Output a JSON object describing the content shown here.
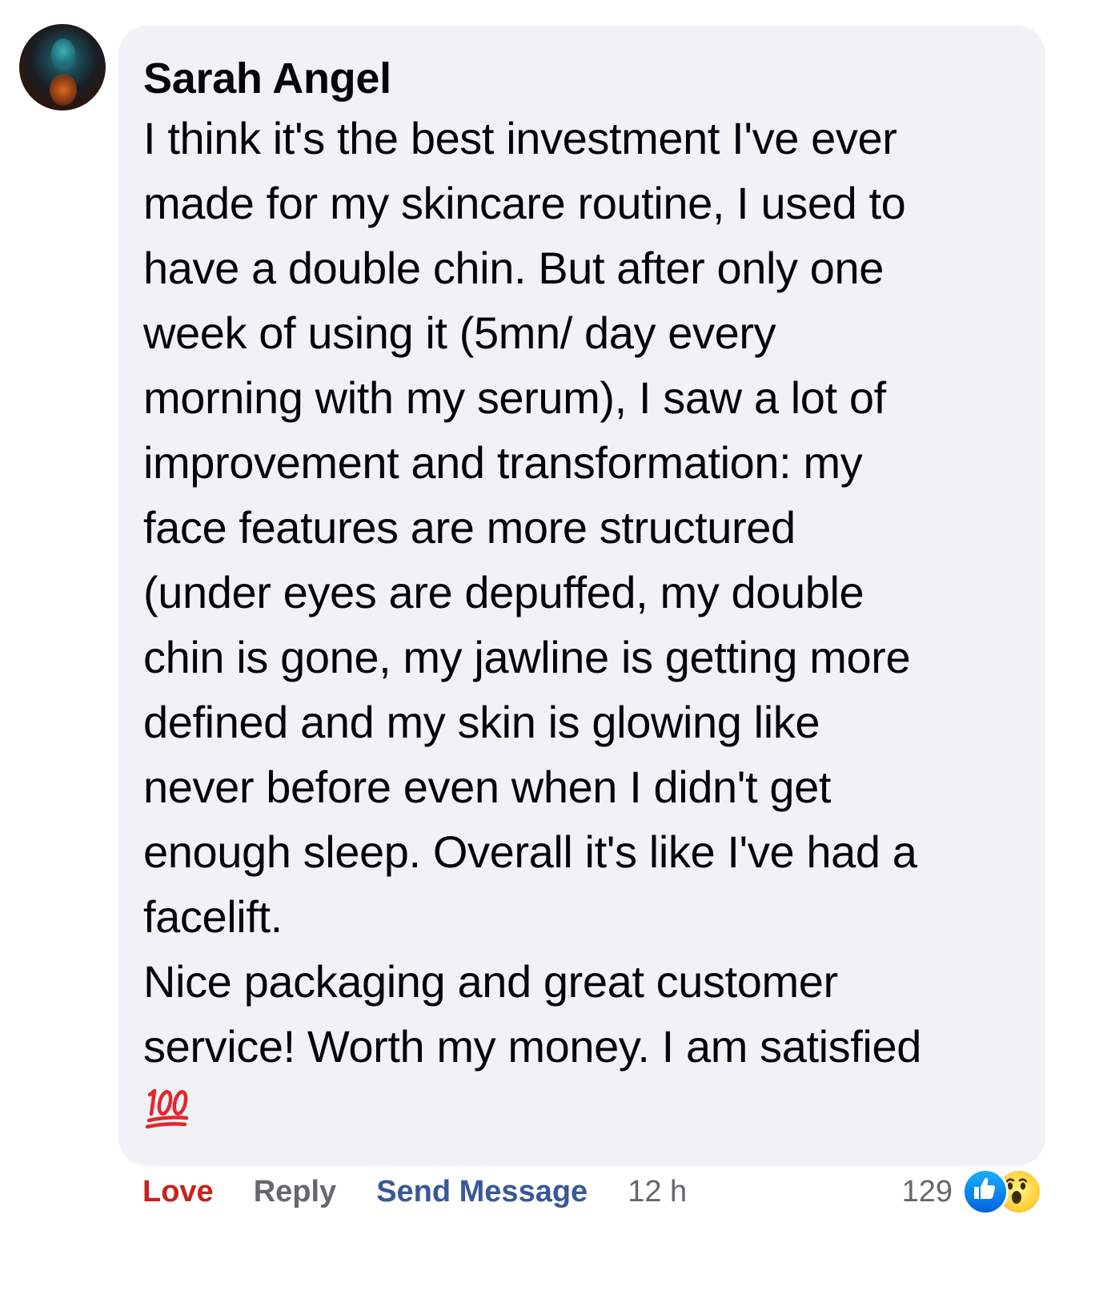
{
  "comment": {
    "author": "Sarah Angel",
    "lines": [
      "I think it's the best investment I've ever",
      "made for my skincare routine, I used to",
      "have a double chin. But after only one",
      "week of using it (5mn/ day every",
      "morning with my serum), I saw a lot of",
      "improvement and transformation: my",
      "face features are more structured",
      "(under eyes are depuffed, my double",
      "chin is gone, my jawline is getting more",
      "defined and my skin is glowing like",
      "never before even when I didn't get",
      "enough sleep. Overall it's like I've had a",
      "facelift.",
      "Nice packaging and great customer",
      "service! Worth my money. I am satisfied"
    ],
    "emoji_icon": "hundred-points-emoji",
    "bubble_color": "#f0f2f5"
  },
  "actions": {
    "love_label": "Love",
    "love_color": "#c9211e",
    "reply_label": "Reply",
    "send_message_label": "Send Message",
    "send_message_color": "#385898",
    "timestamp": "12 h"
  },
  "reactions": {
    "count": "129",
    "icons": [
      "like-icon",
      "wow-icon"
    ]
  }
}
